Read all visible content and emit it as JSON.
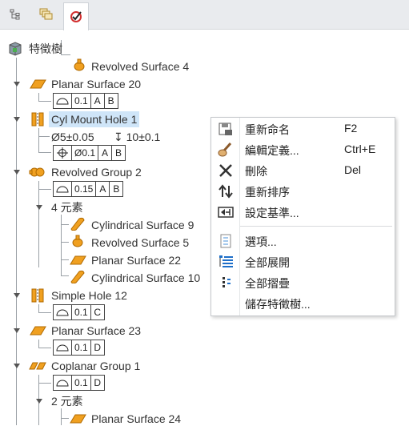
{
  "tabs": [
    {
      "name": "model-tree-tab",
      "icon": "hierarchy-icon"
    },
    {
      "name": "layers-tab",
      "icon": "layers-icon"
    },
    {
      "name": "feature-check-tab",
      "icon": "check-target-icon",
      "active": true
    }
  ],
  "tree": {
    "root": {
      "label": "特徵樹",
      "icon": "part-cube-icon"
    },
    "nodes": [
      {
        "id": "revolved-surface-4",
        "label": "Revolved Surface 4",
        "icon": "revolved-surface-icon"
      },
      {
        "id": "planar-surface-20",
        "label": "Planar Surface 20",
        "icon": "planar-surface-icon",
        "gdt": {
          "symbol": "profile-of-surface",
          "cells": [
            "0.1",
            "A",
            "B"
          ]
        }
      },
      {
        "id": "cyl-mount-hole-1",
        "label": "Cyl Mount Hole 1",
        "icon": "hole-icon",
        "selected": true,
        "dimension": {
          "diameter": "Ø5±0.05",
          "depth": "↧ 10±0.1"
        },
        "gdt": {
          "symbol": "position",
          "cells": [
            "Ø0.1",
            "A",
            "B"
          ]
        }
      },
      {
        "id": "revolved-group-2",
        "label": "Revolved Group 2",
        "icon": "revolved-group-icon",
        "gdt": {
          "symbol": "profile-of-surface",
          "cells": [
            "0.15",
            "A",
            "B"
          ]
        },
        "group": {
          "label": "4 元素",
          "children": [
            {
              "label": "Cylindrical Surface 9",
              "icon": "cylindrical-surface-icon"
            },
            {
              "label": "Revolved Surface 5",
              "icon": "revolved-surface-icon"
            },
            {
              "label": "Planar Surface 22",
              "icon": "planar-surface-icon"
            },
            {
              "label": "Cylindrical Surface 10",
              "icon": "cylindrical-surface-icon"
            }
          ]
        }
      },
      {
        "id": "simple-hole-12",
        "label": "Simple Hole 12",
        "icon": "hole-icon",
        "gdt": {
          "symbol": "profile-of-surface",
          "cells": [
            "0.1",
            "C"
          ]
        }
      },
      {
        "id": "planar-surface-23",
        "label": "Planar Surface 23",
        "icon": "planar-surface-icon",
        "gdt": {
          "symbol": "profile-of-surface",
          "cells": [
            "0.1",
            "D"
          ]
        }
      },
      {
        "id": "coplanar-group-1",
        "label": "Coplanar Group 1",
        "icon": "coplanar-group-icon",
        "gdt": {
          "symbol": "profile-of-surface",
          "cells": [
            "0.1",
            "D"
          ]
        },
        "group": {
          "label": "2 元素",
          "children": [
            {
              "label": "Planar Surface 24",
              "icon": "planar-surface-icon"
            }
          ]
        }
      }
    ]
  },
  "context_menu": {
    "items": [
      {
        "label": "重新命名",
        "shortcut": "F2",
        "icon": "rename-icon"
      },
      {
        "label": "編輯定義...",
        "shortcut": "Ctrl+E",
        "icon": "edit-brush-icon"
      },
      {
        "label": "刪除",
        "shortcut": "Del",
        "icon": "delete-x-icon"
      },
      {
        "label": "重新排序",
        "shortcut": "",
        "icon": "reorder-arrows-icon"
      },
      {
        "label": "設定基準...",
        "shortcut": "",
        "icon": "set-datum-icon"
      },
      {
        "label": "選項...",
        "shortcut": "",
        "icon": "options-icon"
      },
      {
        "label": "全部展開",
        "shortcut": "",
        "icon": "expand-all-icon"
      },
      {
        "label": "全部摺疊",
        "shortcut": "",
        "icon": "collapse-all-icon"
      },
      {
        "label": "儲存特徵樹...",
        "shortcut": "",
        "icon": "save-tree-icon"
      }
    ]
  },
  "colors": {
    "orange": "#f0a020",
    "selection": "#cfe5f8",
    "menu_border": "#c5c8cc"
  }
}
